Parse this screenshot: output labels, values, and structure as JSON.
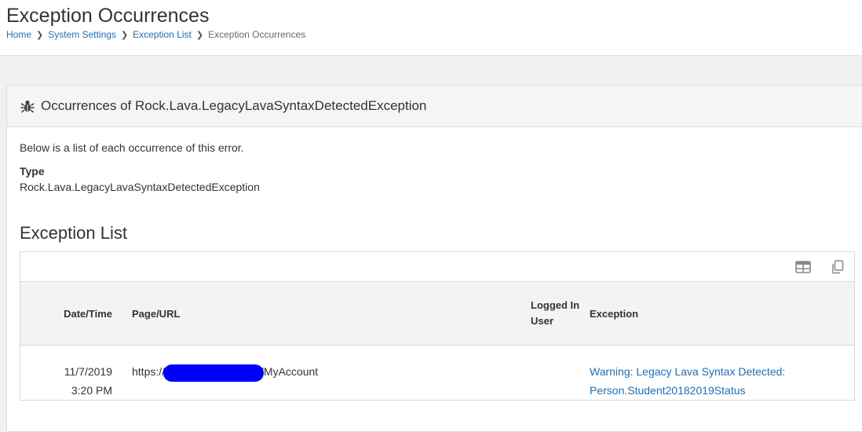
{
  "page": {
    "title": "Exception Occurrences"
  },
  "breadcrumb": {
    "items": [
      {
        "label": "Home"
      },
      {
        "label": "System Settings"
      },
      {
        "label": "Exception List"
      }
    ],
    "current": "Exception Occurrences"
  },
  "panel": {
    "title": "Occurrences of Rock.Lava.LegacyLavaSyntaxDetectedException",
    "icon": "bug-icon",
    "intro": "Below is a list of each occurrence of this error.",
    "type_label": "Type",
    "type_value": "Rock.Lava.LegacyLavaSyntaxDetectedException"
  },
  "exception_list": {
    "title": "Exception List",
    "actions": [
      {
        "icon": "table-icon"
      },
      {
        "icon": "copy-icon"
      }
    ],
    "columns": {
      "date": "Date/Time",
      "url": "Page/URL",
      "user_line1": "Logged In",
      "user_line2": "User",
      "exception": "Exception"
    },
    "rows": [
      {
        "date": "11/7/2019",
        "time": "3:20 PM",
        "url_prefix": "https://",
        "url_suffix": "/MyAccount",
        "user": "",
        "exception_line1": "Warning: Legacy Lava Syntax Detected:",
        "exception_line2": "Person.Student20182019Status"
      }
    ]
  },
  "colors": {
    "link": "#1e6fb3",
    "redaction": "#0000ff"
  }
}
